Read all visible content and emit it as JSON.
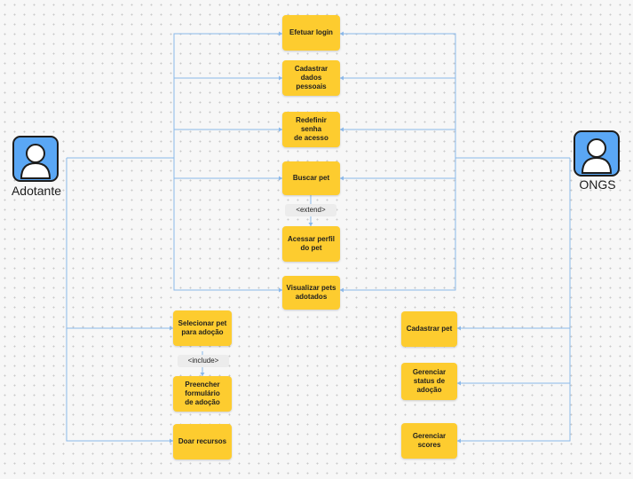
{
  "actors": {
    "left": {
      "name": "Adotante",
      "icon": "user-icon"
    },
    "right": {
      "name": "ONGS",
      "icon": "user-icon"
    }
  },
  "use_cases": {
    "login": "Efetuar login",
    "cadastrar_dados": "Cadastrar\ndados pessoais",
    "redefinir_senha": "Redefinir senha\nde acesso",
    "buscar_pet": "Buscar pet",
    "acessar_perfil": "Acessar perfil\ndo pet",
    "visualizar_adotados": "Visualizar pets\nadotados",
    "selecionar_pet": "Selecionar pet\npara adoção",
    "preencher_formulario": "Preencher\nformulário\nde adoção",
    "doar_recursos": "Doar recursos",
    "cadastrar_pet": "Cadastrar pet",
    "gerenciar_status": "Gerenciar\nstatus de\nadoção",
    "gerenciar_scores": "Gerenciar\nscores"
  },
  "relations": {
    "extend": "<extend>",
    "include": "<include>"
  },
  "colors": {
    "use_case_fill": "#fdcc2f",
    "connector": "#8ab8ea",
    "actor_fill": "#5aa7f5",
    "relation_tag": "#ececec"
  }
}
